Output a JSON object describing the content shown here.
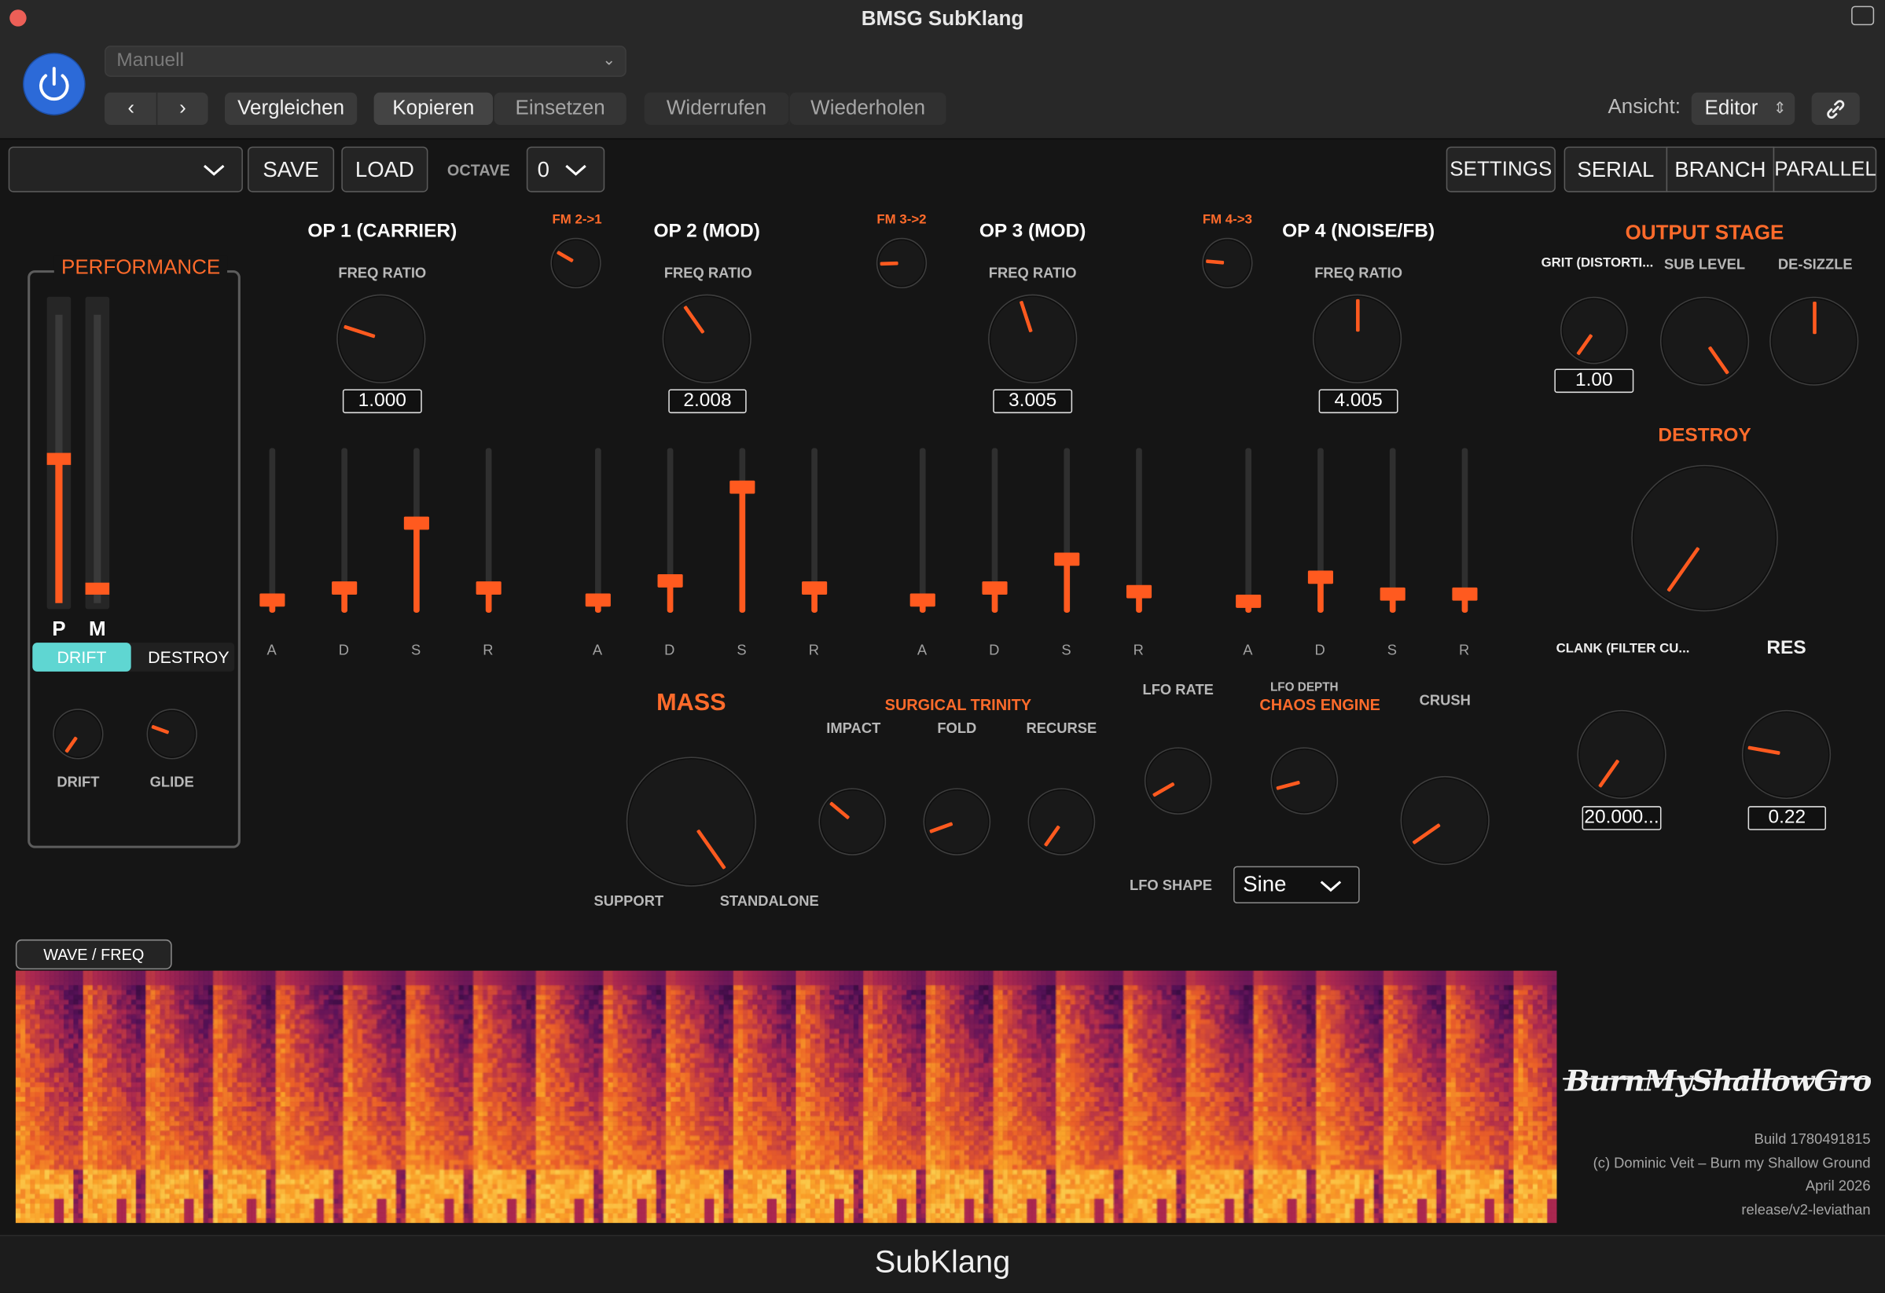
{
  "window": {
    "title": "BMSG SubKlang"
  },
  "host": {
    "preset": "Manuell",
    "compare_label": "Vergleichen",
    "copy_label": "Kopieren",
    "paste_label": "Einsetzen",
    "undo_label": "Widerrufen",
    "redo_label": "Wiederholen",
    "view_label": "Ansicht:",
    "view_value": "Editor"
  },
  "plugin_toolbar": {
    "preset_name": "",
    "save_label": "SAVE",
    "load_label": "LOAD",
    "octave_label": "OCTAVE",
    "octave_value": "0",
    "settings_label": "SETTINGS",
    "routing": [
      "SERIAL",
      "BRANCH",
      "PARALLEL"
    ]
  },
  "performance": {
    "title": "PERFORMANCE",
    "pitch_label": "P",
    "mod_label": "M",
    "pitch_value": 0.5,
    "mod_value": 0.05,
    "toggle_on": "DRIFT",
    "toggle_off": "DESTROY",
    "drift_label": "DRIFT",
    "glide_label": "GLIDE"
  },
  "operators": [
    {
      "title": "OP 1 (CARRIER)",
      "ratio_label": "FREQ RATIO",
      "ratio": "1.000",
      "adsr": [
        0.08,
        0.15,
        0.55,
        0.15
      ]
    },
    {
      "title": "OP 2 (MOD)",
      "ratio_label": "FREQ RATIO",
      "ratio": "2.008",
      "adsr": [
        0.08,
        0.2,
        0.77,
        0.15
      ]
    },
    {
      "title": "OP 3 (MOD)",
      "ratio_label": "FREQ RATIO",
      "ratio": "3.005",
      "adsr": [
        0.08,
        0.15,
        0.33,
        0.13
      ]
    },
    {
      "title": "OP 4 (NOISE/FB)",
      "ratio_label": "FREQ RATIO",
      "ratio": "4.005",
      "adsr": [
        0.07,
        0.22,
        0.12,
        0.12
      ]
    }
  ],
  "adsr_labels": [
    "A",
    "D",
    "S",
    "R"
  ],
  "fm_links": [
    "FM 2->1",
    "FM 3->2",
    "FM 4->3"
  ],
  "output_stage": {
    "title": "OUTPUT STAGE",
    "grit_label": "GRIT (DISTORTI...",
    "grit_value": "1.00",
    "sub_label": "SUB LEVEL",
    "desizzle_label": "DE-SIZZLE",
    "destroy_label": "DESTROY",
    "clank_label": "CLANK (FILTER CU...",
    "clank_value": "20.000...",
    "res_label": "RES",
    "res_value": "0.22"
  },
  "mass": {
    "title": "MASS",
    "support_label": "SUPPORT",
    "standalone_label": "STANDALONE"
  },
  "surgical": {
    "title": "SURGICAL TRINITY",
    "impact_label": "IMPACT",
    "fold_label": "FOLD",
    "recurse_label": "RECURSE"
  },
  "chaos": {
    "title": "CHAOS ENGINE",
    "lfo_rate_label": "LFO RATE",
    "lfo_depth_label": "LFO DEPTH",
    "crush_label": "CRUSH",
    "lfo_shape_label": "LFO SHAPE",
    "lfo_shape": "Sine"
  },
  "visualizer": {
    "tab_label": "WAVE / FREQ"
  },
  "branding": {
    "logo_text": "BurnMyShallowGround",
    "build": "Build 1780491815",
    "copyright": "(c) Dominic Veit – Burn my Shallow Ground",
    "date": "April 2026",
    "release": "release/v2-leviathan"
  },
  "footer": {
    "title": "SubKlang"
  },
  "colors": {
    "accent": "#ff5a1f",
    "toggle": "#5fd6d2",
    "power": "#2c6ad8"
  }
}
